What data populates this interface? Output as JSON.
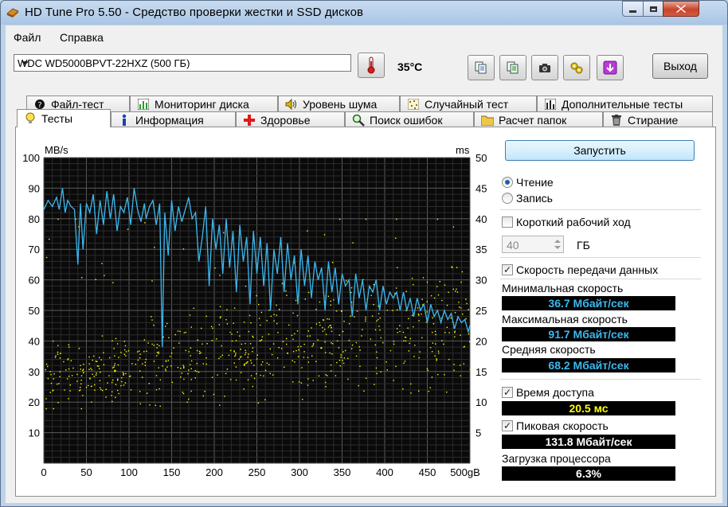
{
  "window": {
    "title": "HD Tune Pro 5.50 - Средство проверки жестки и SSD дисков"
  },
  "menu": {
    "file": "Файл",
    "help": "Справка"
  },
  "toolbar": {
    "drive": "WDC WD5000BPVT-22HXZ (500 ГБ)",
    "temperature": "35°C",
    "exit_label": "Выход"
  },
  "tabs_top": [
    "Файл-тест",
    "Мониторинг диска",
    "Уровень шума",
    "Случайный тест",
    "Дополнительные тесты"
  ],
  "tabs_bottom": [
    "Тесты",
    "Информация",
    "Здоровье",
    "Поиск ошибок",
    "Расчет папок",
    "Стирание"
  ],
  "side": {
    "start_label": "Запустить",
    "read_label": "Чтение",
    "write_label": "Запись",
    "short_stroke_label": "Короткий рабочий ход",
    "short_stroke_value": "40",
    "short_stroke_unit": "ГБ",
    "transfer_label": "Скорость передачи данных",
    "min_label": "Минимальная скорость",
    "min_value": "36.7 Мбайт/сек",
    "max_label": "Максимальная скорость",
    "max_value": "91.7 Мбайт/сек",
    "avg_label": "Средняя скорость",
    "avg_value": "68.2 Мбайт/сек",
    "access_label": "Время доступа",
    "access_value": "20.5 мс",
    "burst_label": "Пиковая скорость",
    "burst_value": "131.8 Мбайт/сек",
    "cpu_label": "Загрузка процессора",
    "cpu_value": "6.3%",
    "colors": {
      "speed": "#3cb8f0",
      "access": "#ffff00",
      "burst": "#ffffff"
    }
  },
  "chart_data": {
    "type": "line",
    "left_unit": "MB/s",
    "right_unit": "ms",
    "x_unit": "gB",
    "xlim": [
      0,
      500
    ],
    "ylim_left": [
      0,
      100
    ],
    "ylim_right": [
      0,
      50
    ],
    "x_ticks": [
      "0",
      "50",
      "100",
      "150",
      "200",
      "250",
      "300",
      "350",
      "400",
      "450",
      "500gB"
    ],
    "y_ticks_left": [
      "10",
      "20",
      "30",
      "40",
      "50",
      "60",
      "70",
      "80",
      "90",
      "100"
    ],
    "y_ticks_right": [
      "5",
      "10",
      "15",
      "20",
      "25",
      "30",
      "35",
      "40",
      "45",
      "50"
    ],
    "grid": true,
    "series": [
      {
        "type": "line",
        "x": [
          0,
          5,
          10,
          15,
          18,
          22,
          25,
          28,
          32,
          36,
          40,
          43,
          46,
          50,
          54,
          58,
          62,
          66,
          70,
          74,
          78,
          82,
          86,
          90,
          94,
          98,
          102,
          106,
          110,
          114,
          118,
          120,
          124,
          128,
          132,
          136,
          139,
          142,
          146,
          150,
          154,
          158,
          162,
          166,
          170,
          174,
          178,
          182,
          186,
          190,
          194,
          198,
          202,
          206,
          210,
          214,
          218,
          222,
          226,
          230,
          234,
          238,
          242,
          246,
          250,
          254,
          258,
          262,
          266,
          270,
          274,
          278,
          282,
          286,
          290,
          294,
          298,
          302,
          306,
          310,
          314,
          318,
          322,
          326,
          330,
          334,
          338,
          342,
          346,
          350,
          354,
          358,
          362,
          366,
          370,
          374,
          378,
          382,
          386,
          390,
          394,
          398,
          402,
          406,
          410,
          414,
          418,
          422,
          426,
          430,
          434,
          438,
          442,
          446,
          450,
          454,
          458,
          462,
          466,
          470,
          474,
          478,
          482,
          486,
          490,
          494,
          498,
          500
        ],
        "y": [
          83,
          86,
          84,
          87,
          83,
          90,
          82,
          86,
          84,
          83,
          65,
          85,
          70,
          85,
          82,
          88,
          75,
          86,
          78,
          89,
          80,
          88,
          76,
          84,
          82,
          87,
          78,
          90,
          83,
          79,
          85,
          80,
          84,
          86,
          78,
          85,
          38,
          82,
          68,
          86,
          76,
          84,
          79,
          83,
          87,
          80,
          82,
          66,
          74,
          84,
          58,
          80,
          70,
          78,
          62,
          80,
          64,
          76,
          56,
          78,
          66,
          74,
          52,
          76,
          62,
          74,
          58,
          72,
          50,
          70,
          62,
          74,
          56,
          72,
          60,
          68,
          52,
          70,
          58,
          68,
          54,
          66,
          60,
          64,
          50,
          66,
          56,
          64,
          52,
          62,
          58,
          60,
          48,
          62,
          54,
          60,
          50,
          58,
          56,
          60,
          50,
          58,
          52,
          56,
          54,
          56,
          50,
          56,
          50,
          54,
          48,
          54,
          50,
          52,
          46,
          52,
          48,
          50,
          46,
          50,
          47,
          49,
          44,
          48,
          46,
          47,
          43,
          45
        ]
      }
    ]
  }
}
